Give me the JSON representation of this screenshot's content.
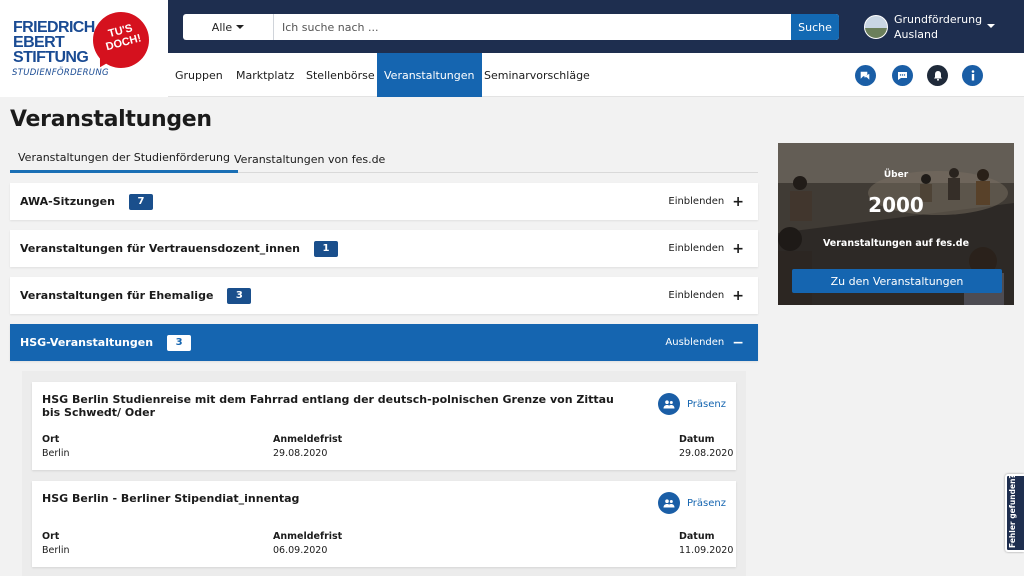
{
  "logo": {
    "line1": "FRIEDRICH",
    "line2": "EBERT",
    "line3": "STIFTUNG",
    "sub": "STUDIENFÖRDERUNG",
    "bubble": "TU'S DOCH!"
  },
  "search": {
    "scope": "Alle",
    "placeholder": "Ich suche nach ...",
    "button": "Suche"
  },
  "user": {
    "name": "Grundförderung Ausland"
  },
  "nav": {
    "items": [
      "Gruppen",
      "Marktplatz",
      "Stellenbörse",
      "Veranstaltungen",
      "Seminarvorschläge"
    ],
    "active": "Veranstaltungen",
    "icons": [
      "chat-icon",
      "message-icon",
      "bell-icon",
      "info-icon"
    ]
  },
  "page": {
    "title": "Veranstaltungen"
  },
  "tabs": [
    "Veranstaltungen der Studienförderung",
    "Veranstaltungen von fes.de"
  ],
  "accordions": [
    {
      "title": "AWA-Sitzungen",
      "count": "7",
      "toggle": "Einblenden",
      "open": false
    },
    {
      "title": "Veranstaltungen für Vertrauensdozent_innen",
      "count": "1",
      "toggle": "Einblenden",
      "open": false
    },
    {
      "title": "Veranstaltungen für Ehemalige",
      "count": "3",
      "toggle": "Einblenden",
      "open": false
    },
    {
      "title": "HSG-Veranstaltungen",
      "count": "3",
      "toggle": "Ausblenden",
      "open": true
    }
  ],
  "labels": {
    "ort": "Ort",
    "anmeldefrist": "Anmeldefrist",
    "datum": "Datum"
  },
  "events": [
    {
      "title": "HSG Berlin Studienreise mit dem Fahrrad entlang der deutsch-polnischen Grenze von Zittau bis Schwedt/ Oder",
      "type": "Präsenz",
      "ort": "Berlin",
      "anmeldefrist": "29.08.2020",
      "datum": "29.08.2020"
    },
    {
      "title": "HSG Berlin - Berliner Stipendiat_innentag",
      "type": "Präsenz",
      "ort": "Berlin",
      "anmeldefrist": "06.09.2020",
      "datum": "11.09.2020"
    }
  ],
  "promo": {
    "small": "Über",
    "big": "2000",
    "sub": "Veranstaltungen auf fes.de",
    "button": "Zu den Veranstaltungen"
  },
  "feedback": {
    "label": "Fehler gefunden?"
  },
  "colors": {
    "header": "#1e2e4f",
    "accent": "#1565b0",
    "badge": "#1a4f8c",
    "logo_red": "#d5111e"
  }
}
